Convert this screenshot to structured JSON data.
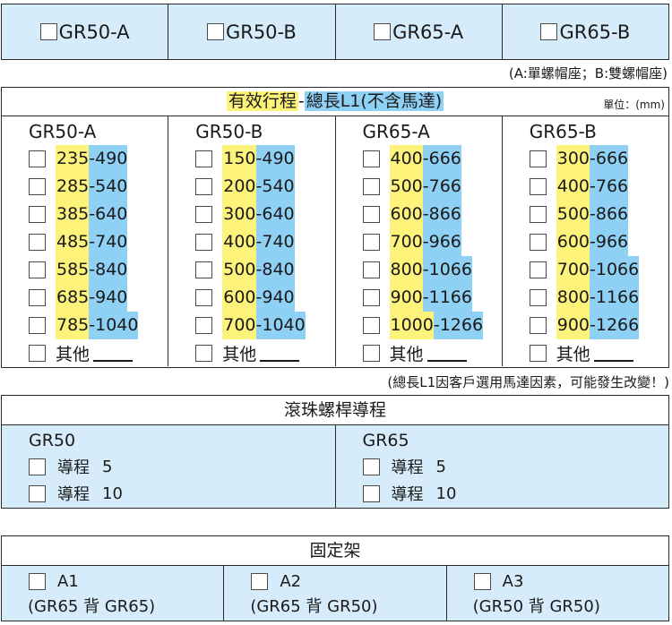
{
  "top_row": {
    "options": [
      "GR50-A",
      "GR50-B",
      "GR65-A",
      "GR65-B"
    ],
    "note": "(A:單螺帽座；B:雙螺帽座)"
  },
  "stroke": {
    "title_yellow": "有效行程",
    "title_sep": "-",
    "title_blue": "總長L1(不含馬達)",
    "unit": "單位：(mm)",
    "other_label": "其他",
    "columns": [
      {
        "title": "GR50-A",
        "ranges": [
          [
            "235",
            "-490"
          ],
          [
            "285",
            "-540"
          ],
          [
            "385",
            "-640"
          ],
          [
            "485",
            "-740"
          ],
          [
            "585",
            "-840"
          ],
          [
            "685",
            "-940"
          ],
          [
            "785",
            "-1040"
          ]
        ]
      },
      {
        "title": "GR50-B",
        "ranges": [
          [
            "150",
            "-490"
          ],
          [
            "200",
            "-540"
          ],
          [
            "300",
            "-640"
          ],
          [
            "400",
            "-740"
          ],
          [
            "500",
            "-840"
          ],
          [
            "600",
            "-940"
          ],
          [
            "700",
            "-1040"
          ]
        ]
      },
      {
        "title": "GR65-A",
        "ranges": [
          [
            "400",
            "-666"
          ],
          [
            "500",
            "-766"
          ],
          [
            "600",
            "-866"
          ],
          [
            "700",
            "-966"
          ],
          [
            "800",
            "-1066"
          ],
          [
            "900",
            "-1166"
          ],
          [
            "1000",
            "-1266"
          ]
        ]
      },
      {
        "title": "GR65-B",
        "ranges": [
          [
            "300",
            "-666"
          ],
          [
            "400",
            "-766"
          ],
          [
            "500",
            "-866"
          ],
          [
            "600",
            "-966"
          ],
          [
            "700",
            "-1066"
          ],
          [
            "800",
            "-1166"
          ],
          [
            "900",
            "-1266"
          ]
        ]
      }
    ],
    "note": "(總長L1因客戶選用馬達因素，可能發生改變！)"
  },
  "lead": {
    "title": "滾珠螺桿導程",
    "columns": [
      {
        "title": "GR50",
        "items": [
          {
            "label": "導程",
            "value": "5"
          },
          {
            "label": "導程",
            "value": "10"
          }
        ]
      },
      {
        "title": "GR65",
        "items": [
          {
            "label": "導程",
            "value": "5"
          },
          {
            "label": "導程",
            "value": "10"
          }
        ]
      }
    ]
  },
  "mount": {
    "title": "固定架",
    "options": [
      {
        "code": "A1",
        "desc": "(GR65 背 GR65)"
      },
      {
        "code": "A2",
        "desc": "(GR65 背 GR50)"
      },
      {
        "code": "A3",
        "desc": "(GR50 背 GR50)"
      }
    ]
  },
  "colors": {
    "light_blue": "#d6ecfa",
    "yellow": "#fdf27a",
    "blue": "#8fd0f5"
  }
}
